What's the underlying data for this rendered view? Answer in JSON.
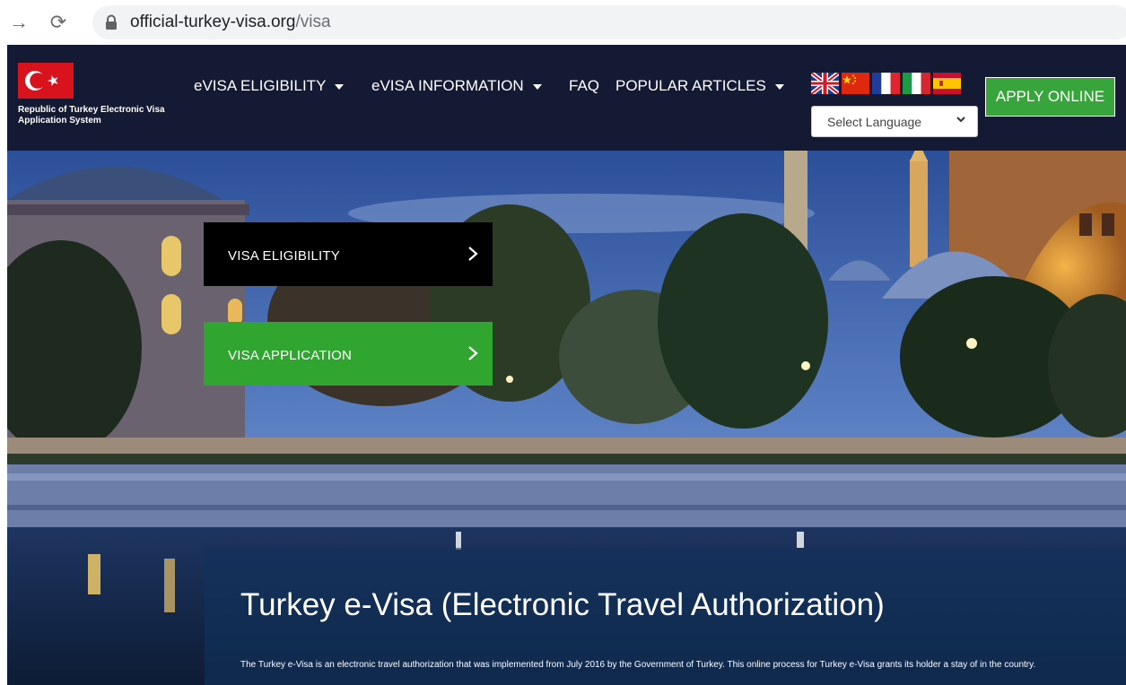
{
  "browser": {
    "url_host": "official-turkey-visa.org",
    "url_path": "/visa"
  },
  "header": {
    "tagline": "Republic of Turkey Electronic Visa Application System",
    "menu": [
      {
        "label": "eVISA ELIGIBILITY",
        "dropdown": true
      },
      {
        "label": "eVISA INFORMATION",
        "dropdown": true
      },
      {
        "label": "FAQ",
        "dropdown": false
      },
      {
        "label": "POPULAR ARTICLES",
        "dropdown": true
      }
    ],
    "language_flags": [
      "uk-flag-icon",
      "china-flag-icon",
      "france-flag-icon",
      "italy-flag-icon",
      "spain-flag-icon"
    ],
    "language_select": {
      "selected": "Select Language"
    },
    "apply_button": "APPLY ONLINE"
  },
  "hero": {
    "cta_eligibility": "VISA ELIGIBILITY",
    "cta_application": "VISA APPLICATION",
    "title": "Turkey e-Visa (Electronic Travel Authorization)",
    "body": "The Turkey e-Visa is an electronic travel authorization that was implemented from July 2016 by the Government of Turkey. This online process for Turkey e-Visa grants its holder a stay of in the country."
  },
  "colors": {
    "header_bg": "#141a33",
    "apply_green": "#37a53b",
    "cta_green": "#30a52f",
    "turkey_red": "#d9131e"
  }
}
